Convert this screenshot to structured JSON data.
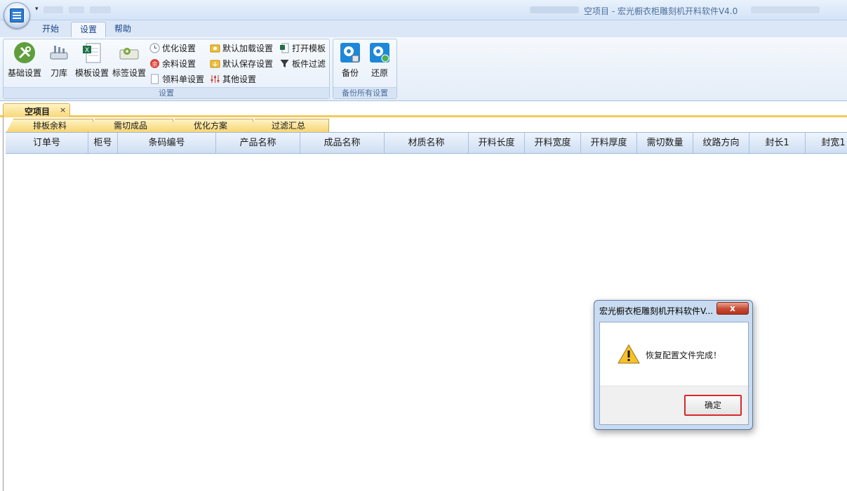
{
  "window": {
    "title": "空项目 - 宏光橱衣柜雕刻机开料软件V4.0"
  },
  "ribbon": {
    "tabs": [
      {
        "label": "开始"
      },
      {
        "label": "设置"
      },
      {
        "label": "帮助"
      }
    ],
    "active_tab": "设置",
    "groups": {
      "settings": {
        "label": "设置",
        "big_buttons": [
          {
            "label": "基础设置",
            "icon": "tools-icon"
          },
          {
            "label": "刀库",
            "icon": "tool-library-icon"
          },
          {
            "label": "模板设置",
            "icon": "excel-template-icon"
          },
          {
            "label": "标签设置",
            "icon": "label-gear-icon"
          }
        ],
        "small_buttons": [
          {
            "label": "优化设置",
            "icon": "clock-icon"
          },
          {
            "label": "余料设置",
            "icon": "remnant-icon"
          },
          {
            "label": "领料单设置",
            "icon": "document-icon"
          },
          {
            "label": "默认加载设置",
            "icon": "folder-load-icon"
          },
          {
            "label": "默认保存设置",
            "icon": "folder-save-icon"
          },
          {
            "label": "其他设置",
            "icon": "sliders-icon"
          },
          {
            "label": "打开模板",
            "icon": "excel-open-icon"
          },
          {
            "label": "板件过滤",
            "icon": "filter-icon"
          }
        ]
      },
      "backup": {
        "label": "备份所有设置",
        "buttons": [
          {
            "label": "备份",
            "icon": "backup-gear-icon"
          },
          {
            "label": "还原",
            "icon": "restore-gear-icon"
          }
        ]
      }
    }
  },
  "document_tab": {
    "label": "空项目",
    "close": "×"
  },
  "sub_tabs": [
    {
      "label": "排板余料"
    },
    {
      "label": "需切成品"
    },
    {
      "label": "优化方案"
    },
    {
      "label": "过滤汇总"
    }
  ],
  "grid": {
    "columns": [
      "订单号",
      "柜号",
      "条码编号",
      "产品名称",
      "成品名称",
      "材质名称",
      "开料长度",
      "开料宽度",
      "开料厚度",
      "需切数量",
      "纹路方向",
      "封长1",
      "封宽1"
    ]
  },
  "dialog": {
    "title": "宏光橱衣柜雕刻机开料软件V...",
    "close_label": "x",
    "message": "恢复配置文件完成！",
    "ok_label": "确定"
  },
  "colors": {
    "ribbon_accent": "#15428b",
    "tab_yellow": "#f7d574",
    "dialog_frame": "#c9dbf0",
    "ok_focus_border": "#d62a2a"
  }
}
